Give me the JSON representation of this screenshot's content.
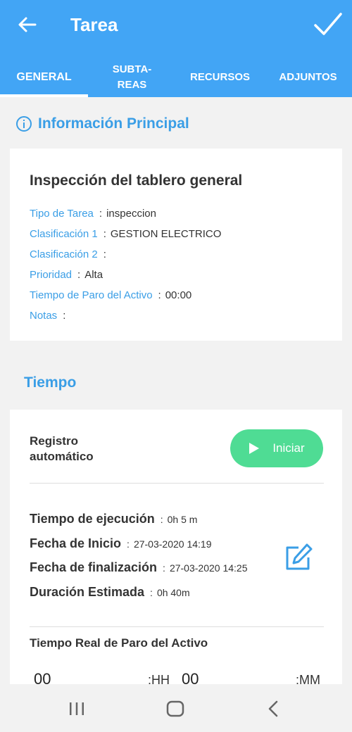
{
  "header": {
    "title": "Tarea"
  },
  "tabs": [
    {
      "label": "GENERAL"
    },
    {
      "label": "SUBTA-\nREAS"
    },
    {
      "label": "RECURSOS"
    },
    {
      "label": "ADJUNTOS"
    }
  ],
  "info": {
    "section_title": "Información Principal",
    "task_title": "Inspección del tablero general",
    "fields": [
      {
        "label": "Tipo de Tarea",
        "value": "inspeccion"
      },
      {
        "label": "Clasificación 1",
        "value": "GESTION ELECTRICO"
      },
      {
        "label": "Clasificación 2",
        "value": ""
      },
      {
        "label": "Prioridad",
        "value": "Alta"
      },
      {
        "label": "Tiempo de Paro del Activo",
        "value": "00:00"
      },
      {
        "label": "Notas",
        "value": ""
      }
    ]
  },
  "time": {
    "section_title": "Tiempo",
    "auto_label": "Registro\nautomático",
    "start_button": "Iniciar",
    "rows": [
      {
        "label": "Tiempo de ejecución",
        "value": "0h 5 m"
      },
      {
        "label": "Fecha de Inicio",
        "value": "27-03-2020 14:19"
      },
      {
        "label": "Fecha de finalización",
        "value": "27-03-2020 14:25"
      },
      {
        "label": "Duración Estimada",
        "value": "0h 40m"
      }
    ],
    "real_stop_title": "Tiempo Real de Paro del Activo",
    "hours_value": "00",
    "hours_unit": ":HH",
    "minutes_value": "00",
    "minutes_unit": ":MM"
  },
  "sep": ":",
  "colors": {
    "primary": "#42a5f5",
    "accent_text": "#3a9ee6",
    "start_button": "#4fdc94"
  },
  "icons": [
    "back-arrow-icon",
    "check-icon",
    "info-icon",
    "play-icon",
    "edit-icon",
    "recents-icon",
    "home-icon",
    "back-icon"
  ]
}
